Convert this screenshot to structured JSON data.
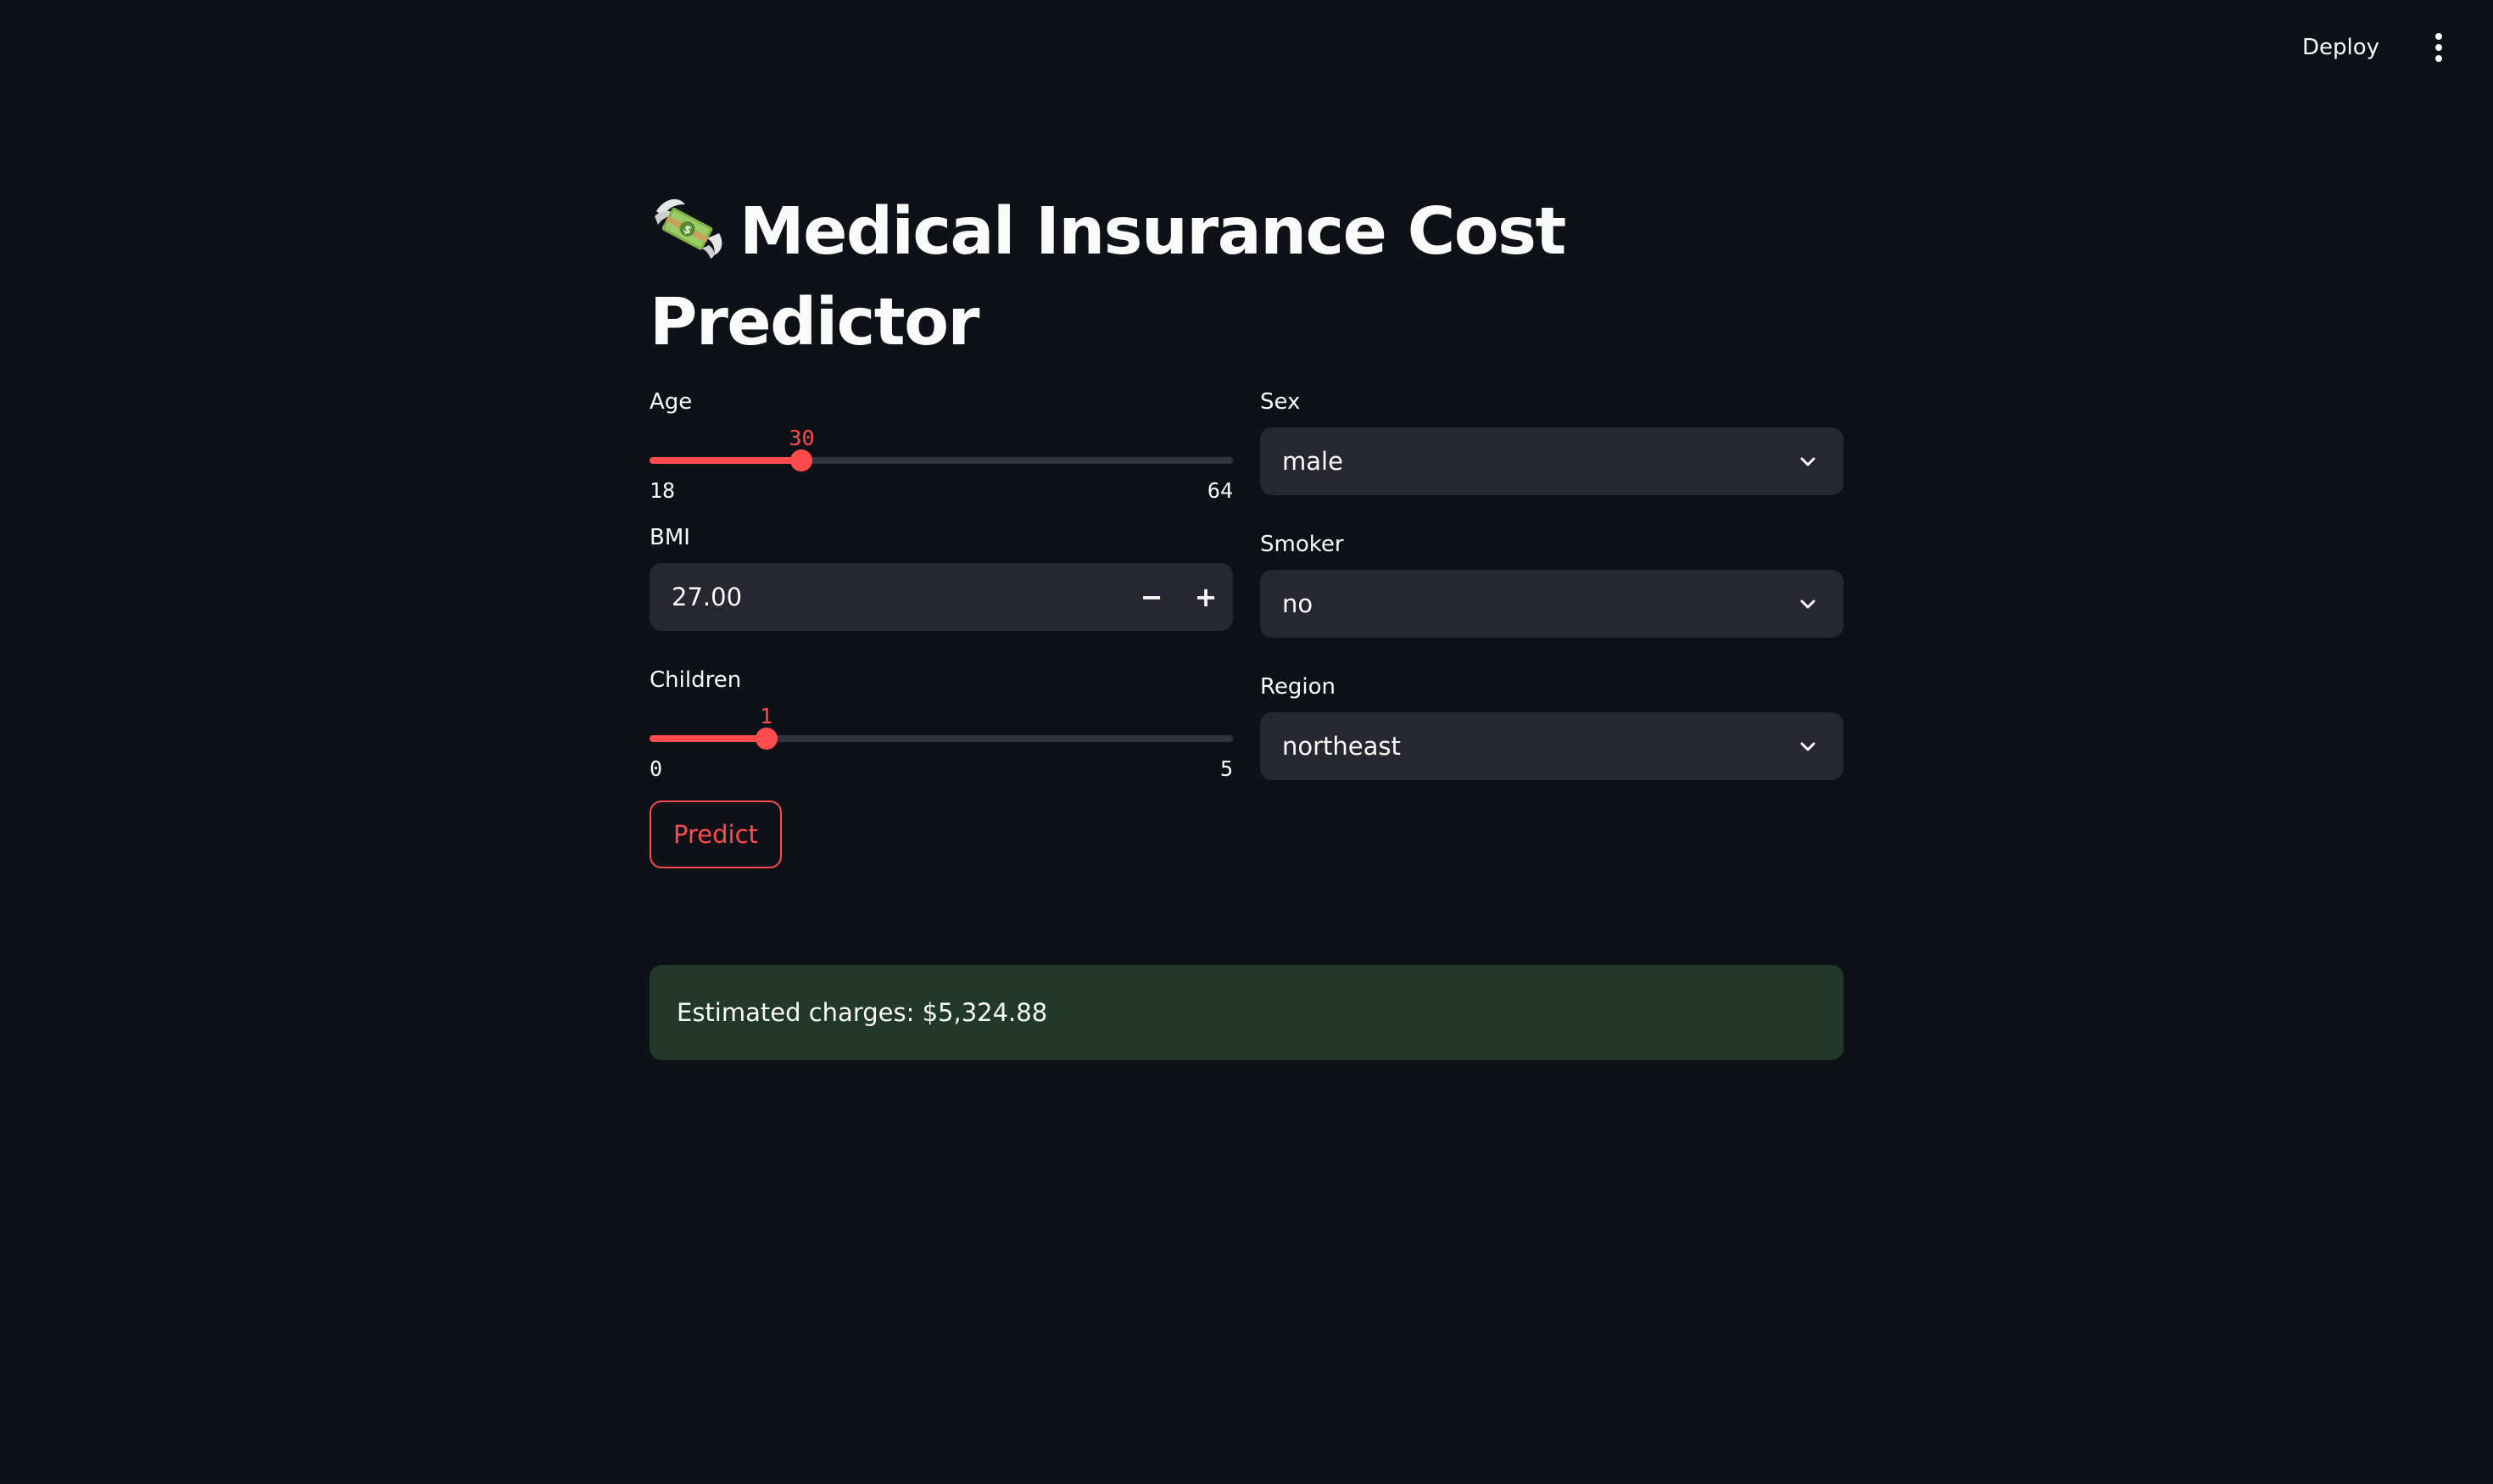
{
  "header": {
    "deploy_label": "Deploy",
    "menu_icon": "three-dots-vertical-icon"
  },
  "page": {
    "title_icon": "money-with-wings-icon",
    "title": "Medical Insurance Cost Predictor"
  },
  "inputs": {
    "age": {
      "label": "Age",
      "value": "30",
      "min": "18",
      "max": "64"
    },
    "bmi": {
      "label": "BMI",
      "value": "27.00",
      "decrement": "−",
      "increment": "+"
    },
    "children": {
      "label": "Children",
      "value": "1",
      "min": "0",
      "max": "5"
    },
    "sex": {
      "label": "Sex",
      "value": "male"
    },
    "smoker": {
      "label": "Smoker",
      "value": "no"
    },
    "region": {
      "label": "Region",
      "value": "northeast"
    }
  },
  "actions": {
    "predict_label": "Predict"
  },
  "result": {
    "text": "Estimated charges: $5,324.88"
  },
  "colors": {
    "background": "#0e1117",
    "accent": "#ff4b4b",
    "input_bg": "#262730",
    "success_bg": "#21382a"
  }
}
